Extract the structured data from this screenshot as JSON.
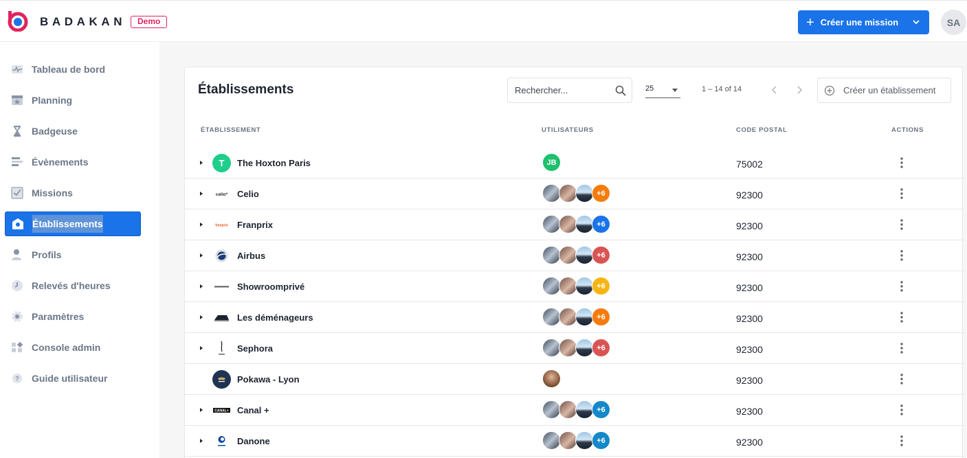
{
  "header": {
    "brand": "BADAKAN",
    "badge": "Demo",
    "create_mission_label": "Créer une mission",
    "user_initials": "SA",
    "accent": "#1a73e8",
    "badge_color": "#e0245e"
  },
  "sidebar": {
    "items": [
      {
        "label": "Tableau de bord",
        "icon": "pulse-icon"
      },
      {
        "label": "Planning",
        "icon": "calendar-star-icon"
      },
      {
        "label": "Badgeuse",
        "icon": "hourglass-icon"
      },
      {
        "label": "Évènements",
        "icon": "list-icon"
      },
      {
        "label": "Missions",
        "icon": "checkbox-icon"
      },
      {
        "label": "Établissements",
        "icon": "building-icon",
        "active": true
      },
      {
        "label": "Profils",
        "icon": "user-icon"
      },
      {
        "label": "Relevés d'heures",
        "icon": "clock-icon"
      },
      {
        "label": "Paramètres",
        "icon": "gear-icon"
      },
      {
        "label": "Console admin",
        "icon": "grid-icon"
      },
      {
        "label": "Guide utilisateur",
        "icon": "help-icon"
      }
    ]
  },
  "main": {
    "title": "Établissements",
    "search_placeholder": "Rechercher...",
    "page_size": "25",
    "pagination_range": "1 – 14 of 14",
    "create_label": "Créer un établissement",
    "columns": [
      "ÉTABLISSEMENT",
      "UTILISATEURS",
      "CODE POSTAL",
      "ACTIONS"
    ],
    "rows": [
      {
        "name": "The Hoxton Paris",
        "postal": "75002",
        "expandable": true,
        "logo": "T",
        "logo_color": "#1fce8a",
        "users": [
          "JB"
        ],
        "extra": ""
      },
      {
        "name": "Celio",
        "postal": "92300",
        "expandable": true,
        "logo": "celio*",
        "users": [
          "a",
          "b",
          "c"
        ],
        "extra": "+6",
        "extra_color": "#f57c0c"
      },
      {
        "name": "Franprix",
        "postal": "92300",
        "expandable": true,
        "logo": "franprix",
        "users": [
          "a",
          "b",
          "c"
        ],
        "extra": "+6",
        "extra_color": "#1a73e8"
      },
      {
        "name": "Airbus",
        "postal": "92300",
        "expandable": true,
        "logo": "airbus",
        "users": [
          "a",
          "b",
          "c"
        ],
        "extra": "+6",
        "extra_color": "#d95454"
      },
      {
        "name": "Showroomprivé",
        "postal": "92300",
        "expandable": true,
        "logo": "showroom",
        "users": [
          "a",
          "b",
          "c"
        ],
        "extra": "+6",
        "extra_color": "#f7b514"
      },
      {
        "name": "Les déménageurs",
        "postal": "92300",
        "expandable": true,
        "logo": "demenageurs",
        "users": [
          "a",
          "b",
          "c"
        ],
        "extra": "+6",
        "extra_color": "#f57c0c"
      },
      {
        "name": "Sephora",
        "postal": "92300",
        "expandable": true,
        "logo": "sephora",
        "users": [
          "a",
          "b",
          "c"
        ],
        "extra": "+6",
        "extra_color": "#d95454"
      },
      {
        "name": "Pokawa - Lyon",
        "postal": "92300",
        "expandable": false,
        "logo": "pokawa",
        "users": [
          "d"
        ],
        "extra": ""
      },
      {
        "name": "Canal +",
        "postal": "92300",
        "expandable": true,
        "logo": "CANAL+",
        "users": [
          "a",
          "b",
          "c"
        ],
        "extra": "+6",
        "extra_color": "#1488c8"
      },
      {
        "name": "Danone",
        "postal": "92300",
        "expandable": true,
        "logo": "danone",
        "users": [
          "a",
          "b",
          "c"
        ],
        "extra": "+6",
        "extra_color": "#1488c8"
      }
    ]
  }
}
